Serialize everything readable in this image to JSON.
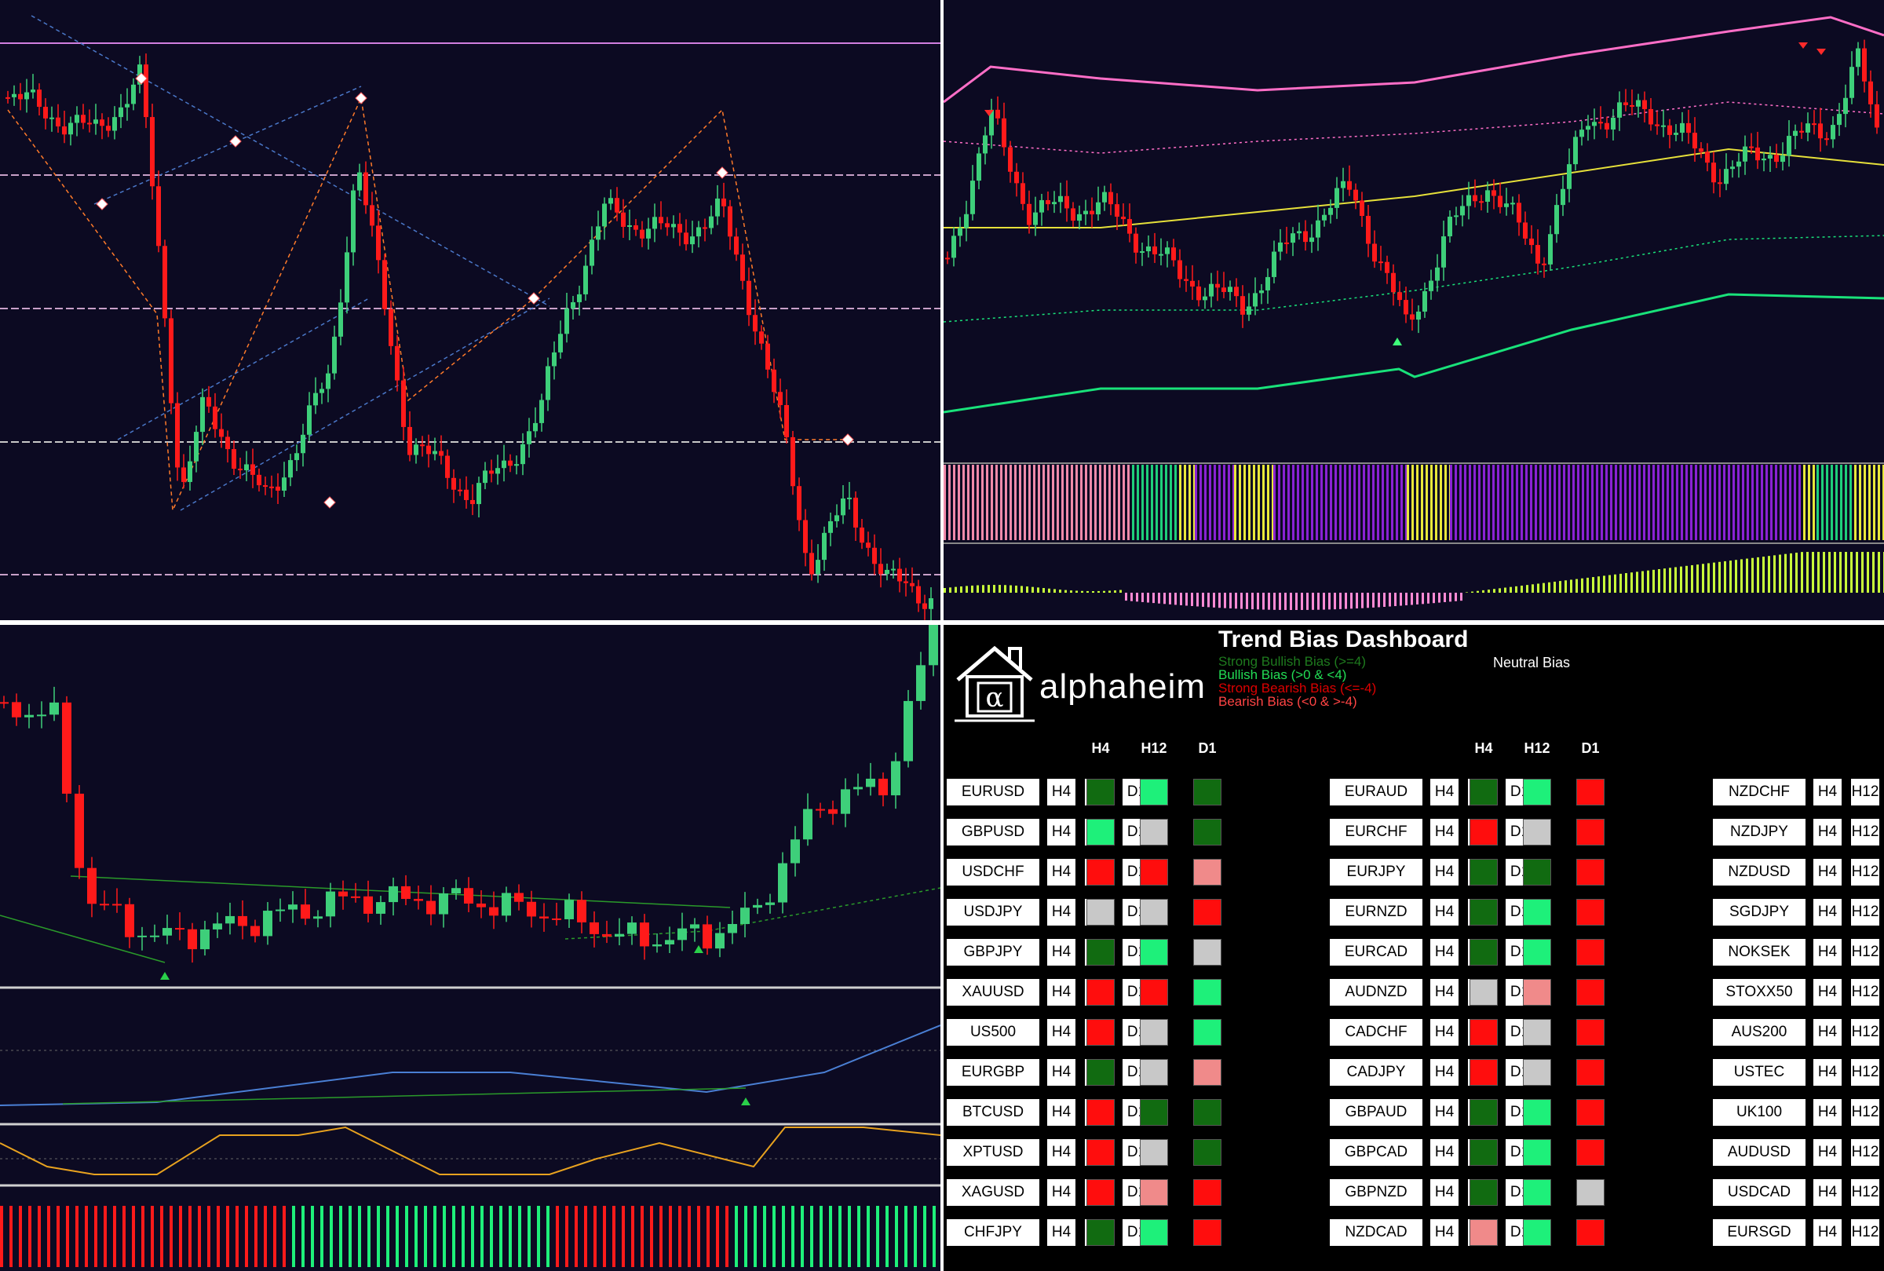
{
  "dashboard": {
    "brand": "alphaheim",
    "logo_symbol": "α",
    "title": "Trend Bias Dashboard",
    "legend": {
      "strong_bullish": "Strong Bullish Bias (>=4)",
      "bullish": "Bullish Bias (>0 & <4)",
      "strong_bearish": "Strong Bearish Bias (<=-4)",
      "bearish": "Bearish Bias (<0 & >-4)",
      "neutral": "Neutral Bias"
    },
    "col_headers": [
      "H4",
      "H12",
      "D1"
    ],
    "timeframes": [
      "H4",
      "H12",
      "D1"
    ],
    "colors": {
      "SG": "#116b11",
      "BG": "#1ef07a",
      "SR": "#ff0d0d",
      "BR": "#f08a8a",
      "N": "#c8c8c8"
    },
    "groups": [
      {
        "rows": [
          {
            "pair": "EURUSD",
            "bias": [
              "SG",
              "BG",
              "SG"
            ]
          },
          {
            "pair": "GBPUSD",
            "bias": [
              "BG",
              "N",
              "SG"
            ]
          },
          {
            "pair": "USDCHF",
            "bias": [
              "SR",
              "SR",
              "BR"
            ]
          },
          {
            "pair": "USDJPY",
            "bias": [
              "N",
              "N",
              "SR"
            ]
          },
          {
            "pair": "GBPJPY",
            "bias": [
              "SG",
              "BG",
              "N"
            ]
          },
          {
            "pair": "XAUUSD",
            "bias": [
              "SR",
              "SR",
              "BG"
            ]
          },
          {
            "pair": "US500",
            "bias": [
              "SR",
              "N",
              "BG"
            ]
          },
          {
            "pair": "EURGBP",
            "bias": [
              "SG",
              "N",
              "BR"
            ]
          },
          {
            "pair": "BTCUSD",
            "bias": [
              "SR",
              "SG",
              "SG"
            ]
          },
          {
            "pair": "XPTUSD",
            "bias": [
              "SR",
              "N",
              "SG"
            ]
          },
          {
            "pair": "XAGUSD",
            "bias": [
              "SR",
              "BR",
              "SR"
            ]
          },
          {
            "pair": "CHFJPY",
            "bias": [
              "SG",
              "BG",
              "SR"
            ]
          }
        ]
      },
      {
        "rows": [
          {
            "pair": "EURAUD",
            "bias": [
              "SG",
              "BG",
              "SR"
            ]
          },
          {
            "pair": "EURCHF",
            "bias": [
              "SR",
              "N",
              "SR"
            ]
          },
          {
            "pair": "EURJPY",
            "bias": [
              "SG",
              "SG",
              "SR"
            ]
          },
          {
            "pair": "EURNZD",
            "bias": [
              "SG",
              "BG",
              "SR"
            ]
          },
          {
            "pair": "EURCAD",
            "bias": [
              "SG",
              "BG",
              "SR"
            ]
          },
          {
            "pair": "AUDNZD",
            "bias": [
              "N",
              "BR",
              "SR"
            ]
          },
          {
            "pair": "CADCHF",
            "bias": [
              "SR",
              "N",
              "SR"
            ]
          },
          {
            "pair": "CADJPY",
            "bias": [
              "SR",
              "N",
              "SR"
            ]
          },
          {
            "pair": "GBPAUD",
            "bias": [
              "SG",
              "BG",
              "SR"
            ]
          },
          {
            "pair": "GBPCAD",
            "bias": [
              "SG",
              "BG",
              "SR"
            ]
          },
          {
            "pair": "GBPNZD",
            "bias": [
              "SG",
              "BG",
              "N"
            ]
          },
          {
            "pair": "NZDCAD",
            "bias": [
              "BR",
              "BG",
              "SR"
            ]
          }
        ]
      },
      {
        "rows": [
          {
            "pair": "NZDCHF"
          },
          {
            "pair": "NZDJPY"
          },
          {
            "pair": "NZDUSD"
          },
          {
            "pair": "SGDJPY"
          },
          {
            "pair": "NOKSEK"
          },
          {
            "pair": "STOXX50"
          },
          {
            "pair": "AUS200"
          },
          {
            "pair": "USTEC"
          },
          {
            "pair": "UK100"
          },
          {
            "pair": "AUDUSD"
          },
          {
            "pair": "USDCAD"
          },
          {
            "pair": "EURSGD"
          }
        ]
      }
    ]
  },
  "chart_colors": {
    "background": "#0c0a22",
    "bull_candle": "#3ecf7a",
    "bear_candle": "#ff1a1a",
    "envelope_upper": "#ff6ec7",
    "envelope_lower": "#19e27a",
    "ma": "#e6e03a",
    "osc_blue": "#4a7fd4",
    "osc_orange": "#e8a21f"
  }
}
